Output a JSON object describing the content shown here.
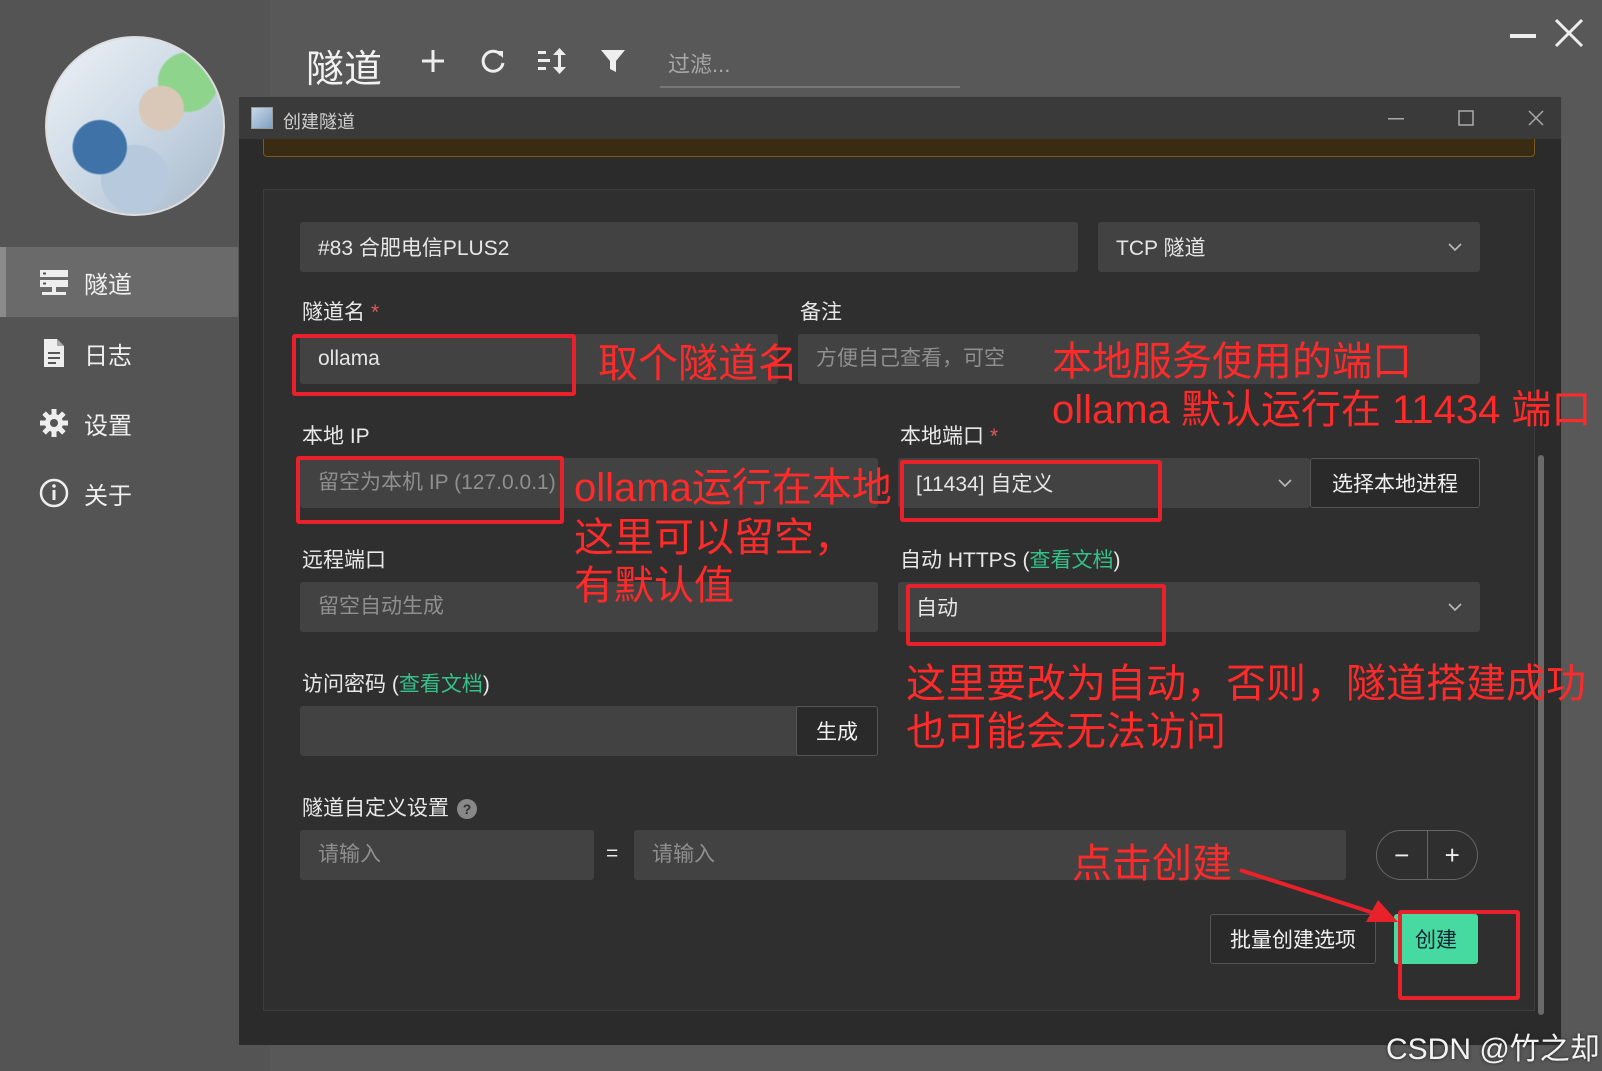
{
  "app": {
    "page_title": "隧道",
    "filter_placeholder": "过滤..."
  },
  "sidebar": {
    "items": [
      {
        "label": "隧道",
        "icon": "server-icon",
        "active": true
      },
      {
        "label": "日志",
        "icon": "document-icon",
        "active": false
      },
      {
        "label": "设置",
        "icon": "gear-icon",
        "active": false
      },
      {
        "label": "关于",
        "icon": "info-icon",
        "active": false
      }
    ]
  },
  "dialog": {
    "title": "创建隧道",
    "node_select": "#83 合肥电信PLUS2",
    "type_select": "TCP 隧道",
    "tunnel_name_label": "隧道名",
    "tunnel_name_value": "ollama",
    "required_mark": "*",
    "remark_label": "备注",
    "remark_placeholder": "方便自己查看，可空",
    "local_ip_label": "本地 IP",
    "local_ip_placeholder": "留空为本机 IP (127.0.0.1)",
    "local_port_label": "本地端口",
    "local_port_value": "[11434] 自定义",
    "choose_process_button": "选择本地进程",
    "remote_port_label": "远程端口",
    "remote_port_placeholder": "留空自动生成",
    "auto_https_label": "自动 HTTPS (",
    "auto_https_link": "查看文档",
    "auto_https_close": ")",
    "auto_https_value": "自动",
    "access_password_label": "访问密码 (",
    "access_password_link": "查看文档",
    "access_password_close": ")",
    "generate_button": "生成",
    "custom_settings_label": "隧道自定义设置",
    "help_glyph": "?",
    "key_placeholder": "请输入",
    "equals": "=",
    "value_placeholder": "请输入",
    "minus_glyph": "−",
    "plus_glyph": "+",
    "batch_button": "批量创建选项",
    "create_button": "创建"
  },
  "annotations": {
    "name_note": "取个隧道名",
    "port_note_line1": "本地服务使用的端口",
    "port_note_line2": "ollama 默认运行在 11434 端口",
    "ip_note_line1": "ollama运行在本地",
    "ip_note_line2": "这里可以留空，",
    "ip_note_line3": "有默认值",
    "https_note_line1": "这里要改为自动，否则，隧道搭建成功",
    "https_note_line2": "也可能会无法访问",
    "create_note": "点击创建"
  },
  "watermark": "CSDN @竹之却",
  "colors": {
    "accent_green": "#46d9a0",
    "link_green": "#35c28a",
    "annotation_red": "#e8212a",
    "required_red": "#e05a5a"
  }
}
